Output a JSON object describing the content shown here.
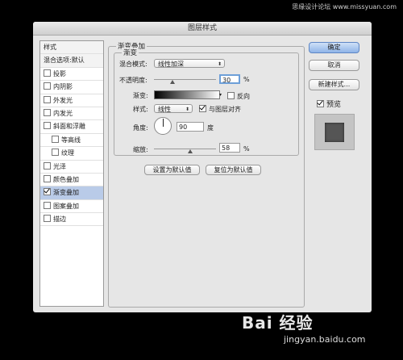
{
  "watermark_top": "思缘设计论坛 www.missyuan.com",
  "dialog": {
    "title": "图层样式"
  },
  "styles_list": {
    "items": [
      {
        "label": "样式",
        "type": "hdr",
        "checked": false
      },
      {
        "label": "混合选项:默认",
        "type": "hdr",
        "checked": false
      },
      {
        "label": "投影",
        "type": "cb",
        "checked": false
      },
      {
        "label": "内阴影",
        "type": "cb",
        "checked": false
      },
      {
        "label": "外发光",
        "type": "cb",
        "checked": false
      },
      {
        "label": "内发光",
        "type": "cb",
        "checked": false
      },
      {
        "label": "斜面和浮雕",
        "type": "cb",
        "checked": false
      },
      {
        "label": "等高线",
        "type": "sub",
        "checked": false
      },
      {
        "label": "纹理",
        "type": "sub",
        "checked": false
      },
      {
        "label": "光泽",
        "type": "cb",
        "checked": false
      },
      {
        "label": "颜色叠加",
        "type": "cb",
        "checked": false
      },
      {
        "label": "渐变叠加",
        "type": "cb",
        "checked": true,
        "selected": true
      },
      {
        "label": "图案叠加",
        "type": "cb",
        "checked": false
      },
      {
        "label": "描边",
        "type": "cb",
        "checked": false
      }
    ]
  },
  "panel": {
    "outer_title": "渐变叠加",
    "inner_title": "渐变",
    "blend_mode_label": "混合模式:",
    "blend_mode_value": "线性加深",
    "opacity_label": "不透明度:",
    "opacity_value": "30",
    "opacity_unit": "%",
    "opacity_level": 0.3,
    "gradient_label": "渐变:",
    "reverse_label": "反向",
    "reverse_checked": false,
    "style_label": "样式:",
    "style_value": "线性",
    "align_label": "与图层对齐",
    "align_checked": true,
    "angle_label": "角度:",
    "angle_value": "90",
    "angle_unit": "度",
    "scale_label": "缩放:",
    "scale_value": "58",
    "scale_unit": "%",
    "scale_level": 0.58,
    "make_default": "设置为默认值",
    "reset_default": "复位为默认值"
  },
  "buttons": {
    "ok": "确定",
    "cancel": "取消",
    "new_style": "新建样式...",
    "preview_label": "预览",
    "preview_checked": true
  },
  "watermark_bottom": "Bai 经验",
  "watermark_url": "jingyan.baidu.com"
}
